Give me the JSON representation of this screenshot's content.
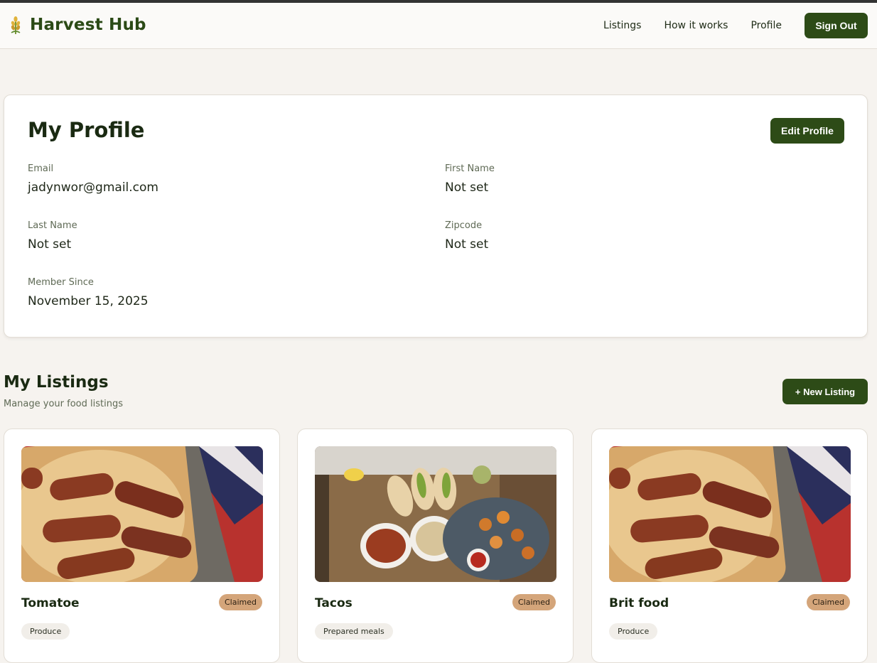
{
  "app": {
    "name": "Harvest Hub",
    "logo_icon": "wheat-icon"
  },
  "nav": {
    "links": [
      "Listings",
      "How it works",
      "Profile"
    ],
    "sign_out": "Sign Out"
  },
  "profile": {
    "title": "My Profile",
    "edit_label": "Edit Profile",
    "fields": {
      "email": {
        "label": "Email",
        "value": "jadynwor@gmail.com"
      },
      "first_name": {
        "label": "First Name",
        "value": "Not set"
      },
      "last_name": {
        "label": "Last Name",
        "value": "Not set"
      },
      "zipcode": {
        "label": "Zipcode",
        "value": "Not set"
      },
      "member_since": {
        "label": "Member Since",
        "value": "November 15, 2025"
      }
    }
  },
  "listings": {
    "title": "My Listings",
    "subtitle": "Manage your food listings",
    "new_label": "+ New Listing",
    "items": [
      {
        "title": "Tomatoe",
        "status": "Claimed",
        "category": "Produce",
        "image": "toad-in-the-hole-photo"
      },
      {
        "title": "Tacos",
        "status": "Claimed",
        "category": "Prepared meals",
        "image": "tacos-platter-photo"
      },
      {
        "title": "Brit food",
        "status": "Claimed",
        "category": "Produce",
        "image": "toad-in-the-hole-photo"
      }
    ]
  },
  "colors": {
    "accent": "#2d4b17",
    "badge_claimed": "#d4a57a",
    "badge_category": "#f1eee9",
    "page_bg": "#f6f3ef"
  }
}
